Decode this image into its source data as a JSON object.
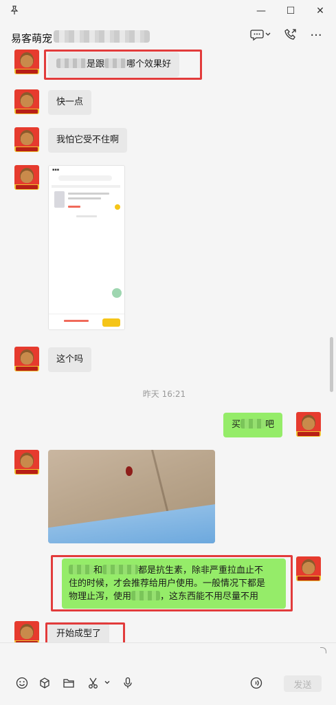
{
  "window": {
    "pin_icon": "pin-icon",
    "minimize": "—",
    "maximize": "☐",
    "close": "✕"
  },
  "header": {
    "contact_name": "易客萌宠",
    "more": "···"
  },
  "messages": {
    "m1": {
      "suffix": "是跟",
      "suffix2": "哪个效果好"
    },
    "m2": "快一点",
    "m3": "我怕它受不住啊",
    "m5": "这个吗",
    "timestamp": "昨天 16:21",
    "m6": {
      "prefix": "买",
      "suffix": "吧"
    },
    "m8": {
      "line1_a": "和",
      "line1_b": "都是抗生素，除非严重拉血止不",
      "line2": "住的时候，才会推荐给用户使用。一般情况下都是",
      "line3_a": "物理止泻，使用",
      "line3_b": "，这东西能不用尽量不用"
    },
    "m9": "开始成型了"
  },
  "composer": {
    "send_label": "发送"
  },
  "colors": {
    "self_bubble": "#95ec69",
    "other_bubble": "#e8e8e8",
    "highlight": "#e23b3b"
  }
}
